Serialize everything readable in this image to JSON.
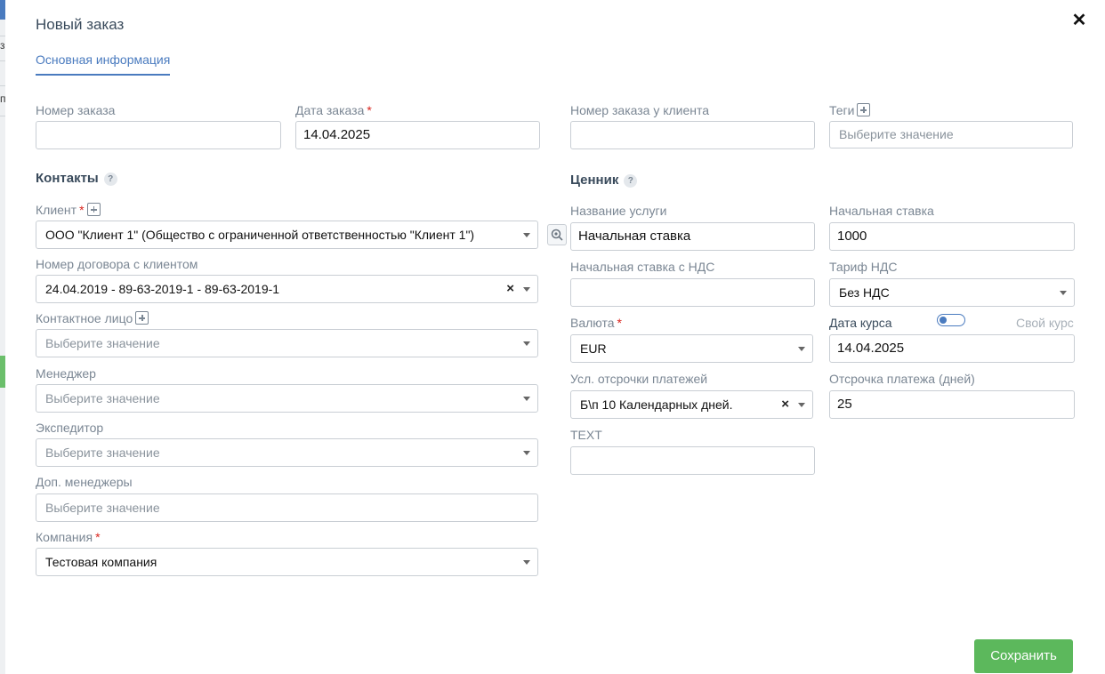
{
  "background": {
    "fragment_1": "з",
    "fragment_2": "п"
  },
  "modal": {
    "title": "Новый заказ",
    "close_glyph": "✕"
  },
  "tabs": [
    {
      "label": "Основная информация"
    }
  ],
  "order": {
    "number_label": "Номер заказа",
    "number_value": "",
    "date_label": "Дата заказа",
    "date_value": "14.04.2025",
    "client_number_label": "Номер заказа у клиента",
    "client_number_value": "",
    "tags_label": "Теги",
    "tags_placeholder": "Выберите значение"
  },
  "contacts": {
    "title": "Контакты",
    "client_label": "Клиент",
    "client_value": "ООО \"Клиент 1\" (Общество с ограниченной ответственностью \"Клиент 1\")",
    "contract_label": "Номер договора с клиентом",
    "contract_value": "24.04.2019 - 89-63-2019-1 - 89-63-2019-1",
    "contact_person_label": "Контактное лицо",
    "contact_person_placeholder": "Выберите значение",
    "manager_label": "Менеджер",
    "manager_placeholder": "Выберите значение",
    "forwarder_label": "Экспедитор",
    "forwarder_placeholder": "Выберите значение",
    "extra_managers_label": "Доп. менеджеры",
    "extra_managers_placeholder": "Выберите значение",
    "company_label": "Компания",
    "company_value": "Тестовая компания"
  },
  "pricing": {
    "title": "Ценник",
    "service_name_label": "Название услуги",
    "service_name_value": "Начальная ставка",
    "initial_rate_label": "Начальная ставка",
    "initial_rate_value": "1000",
    "initial_rate_vat_label": "Начальная ставка с НДС",
    "initial_rate_vat_value": "",
    "vat_tariff_label": "Тариф НДС",
    "vat_tariff_value": "Без НДС",
    "currency_label": "Валюта",
    "currency_value": "EUR",
    "rate_date_label": "Дата курса",
    "own_rate_label": "Свой курс",
    "rate_date_value": "14.04.2025",
    "payment_terms_label": "Усл. отсрочки платежей",
    "payment_terms_value": "Б\\п 10 Календарных дней.",
    "payment_delay_label": "Отсрочка платежа (дней)",
    "payment_delay_value": "25",
    "text_label": "TEXT",
    "text_value": ""
  },
  "footer": {
    "save_label": "Сохранить"
  },
  "colors": {
    "accent": "#4a7bbf",
    "save": "#5cb85c",
    "required": "#d9241d"
  }
}
